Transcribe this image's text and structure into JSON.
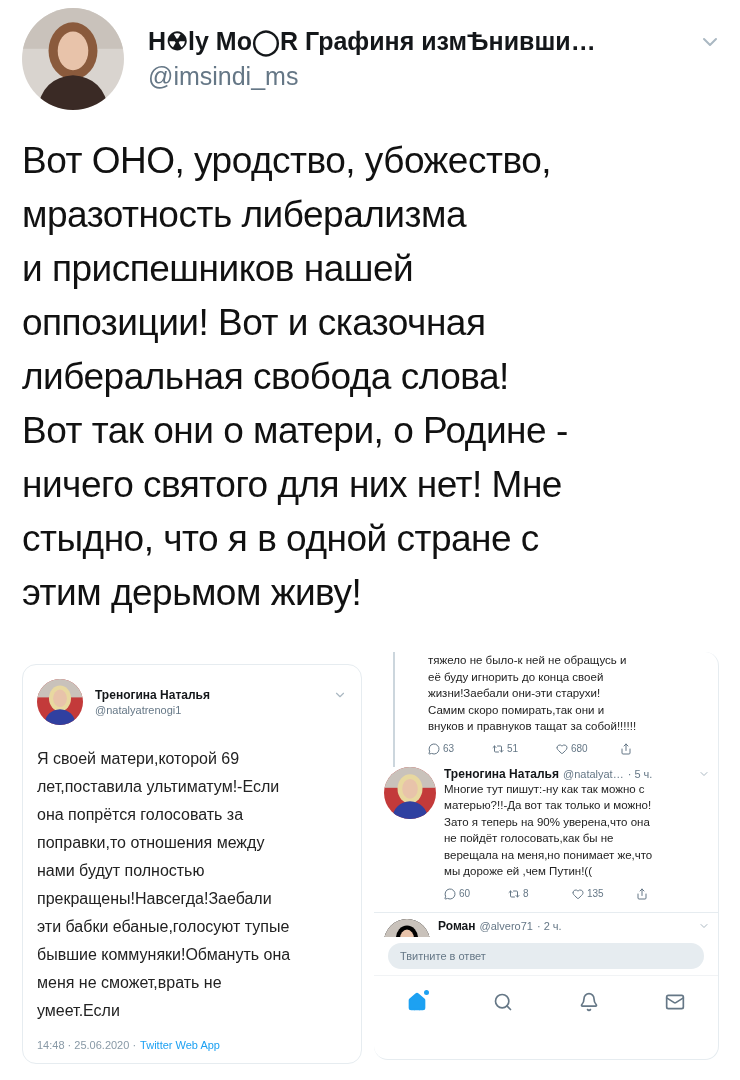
{
  "tweet": {
    "author_name": "H☢ly Mo◯R Графиня измѢнивши…",
    "handle": "@imsindi_ms",
    "text": "Вот ОНО, уродство, убожество,\nмразотность либерализма\nи приспешников нашей\nоппозиции! Вот и сказочная\nлиберальная свобода слова!\nВот так они о матери, о Родине -\nничего святого для них нет! Мне\nстыдно, что я в одной стране с\nэтим дерьмом живу!"
  },
  "left_screenshot": {
    "author_name": "Треногина Наталья",
    "handle": "@natalyatrenogi1",
    "text": "Я своей матери,которой 69\nлет,поставила ультиматум!-Если\nона попрётся голосовать за\nпоправки,то отношения между\nнами будут полностью\nпрекращены!Навсегда!Заебали\nэти бабки ебаные,голосуют тупые\nбывшие коммуняки!Обмануть она\nменя не сможет,врать не\nумеет.Если",
    "timestamp": "14:48 · 25.06.2020 ·",
    "source": "Twitter Web App"
  },
  "right_screenshot": {
    "previous_reply": {
      "text": "тяжело не было-к ней не обращусь и\neё буду игнорить до конца своей\nжизни!Заебали они-эти старухи!\nСамим  скоро помирать,так они и\nвнуков и правнуков тащат за собой!!!!!!",
      "replies": "63",
      "retweets": "51",
      "likes": "680"
    },
    "replies": [
      {
        "name": "Треногина Наталья",
        "handle": "@natalyat…",
        "time": "· 5 ч.",
        "text": "Многие тут пишут:-ну как так можно с\nматерью?!!-Да вот так только и можно!\nЗато я теперь на 90% уверена,что она\nне пойдёт голосовать,как бы не\nверещала на меня,но понимает же,что\nмы дороже ей ,чем Путин!((",
        "replies": "60",
        "retweets": "8",
        "likes": "135"
      },
      {
        "name": "Роман",
        "handle": "@alvero71",
        "time": "· 2 ч."
      }
    ],
    "reply_field": {
      "placeholder": "Твитните в ответ"
    },
    "nav": [
      {
        "kind": "home",
        "selected": true,
        "unread": true
      },
      {
        "kind": "search",
        "selected": false,
        "unread": false
      },
      {
        "kind": "notifications",
        "selected": false,
        "unread": false
      },
      {
        "kind": "messages",
        "selected": false,
        "unread": false
      }
    ]
  }
}
